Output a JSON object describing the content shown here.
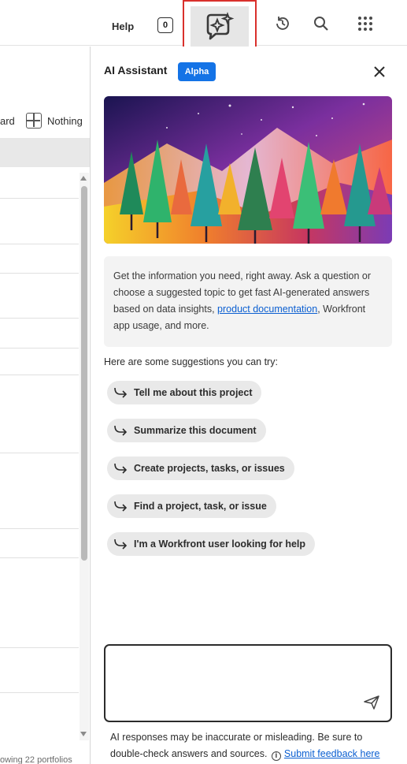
{
  "topbar": {
    "help_label": "Help",
    "notification_count": "0",
    "icons": [
      "ai-assistant-icon",
      "history-icon",
      "search-icon",
      "app-grid-icon"
    ]
  },
  "left_app": {
    "toolbar_partial_label": "ard",
    "nothing_label": "Nothing",
    "footer_text": "owing 22 portfolios"
  },
  "panel": {
    "title": "AI Assistant",
    "badge": "Alpha",
    "info_text_before_link": "Get the information you need, right away. Ask a question or choose a suggested topic to get fast AI-generated answers based on data insights, ",
    "info_link": "product documentation",
    "info_text_after_link": ", Workfront app usage, and more.",
    "suggestions_title": "Here are some suggestions you can try:",
    "suggestions": [
      "Tell me about this project",
      "Summarize this document",
      "Create projects, tasks, or issues",
      "Find a project, task, or issue",
      "I'm a Workfront user looking for help"
    ],
    "input_value": "",
    "disclaimer_text": "AI responses may be inaccurate or misleading. Be sure to double-check answers and sources.",
    "feedback_link": "Submit feedback here"
  },
  "colors": {
    "accent_blue": "#1473e6",
    "highlight_red": "#d9302c",
    "chip_bg": "#e9e9e9",
    "info_bg": "#f3f3f3"
  }
}
